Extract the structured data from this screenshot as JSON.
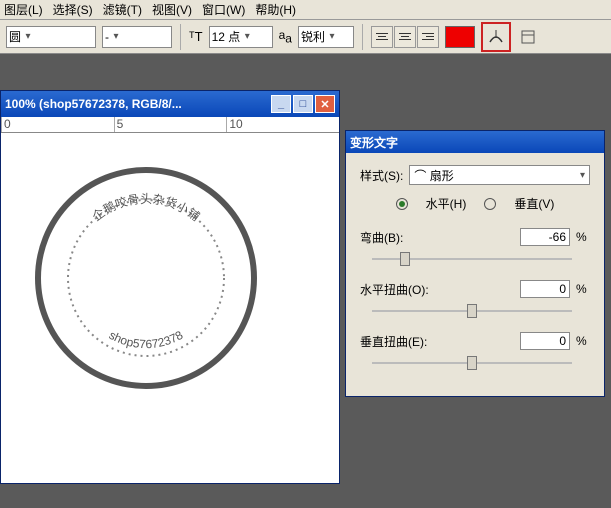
{
  "menu": {
    "layer": "图层(L)",
    "select": "选择(S)",
    "filter": "滤镜(T)",
    "view": "视图(V)",
    "window": "窗口(W)",
    "help": "帮助(H)"
  },
  "tool": {
    "font": "圆",
    "size": "12 点",
    "aa": "锐利"
  },
  "doc": {
    "title": "100% (shop57672378, RGB/8/...",
    "ruler": [
      "0",
      "5",
      "10"
    ]
  },
  "stamp": {
    "text_top": "企鹅咬骨头杂货小铺",
    "text_bottom": "shop57672378"
  },
  "panel": {
    "title": "变形文字",
    "style_lbl": "样式(S):",
    "style_val": "扇形",
    "horiz": "水平(H)",
    "vert": "垂直(V)",
    "bend_lbl": "弯曲(B):",
    "bend_val": "-66",
    "hdist_lbl": "水平扭曲(O):",
    "hdist_val": "0",
    "vdist_lbl": "垂直扭曲(E):",
    "vdist_val": "0",
    "pct": "%"
  }
}
